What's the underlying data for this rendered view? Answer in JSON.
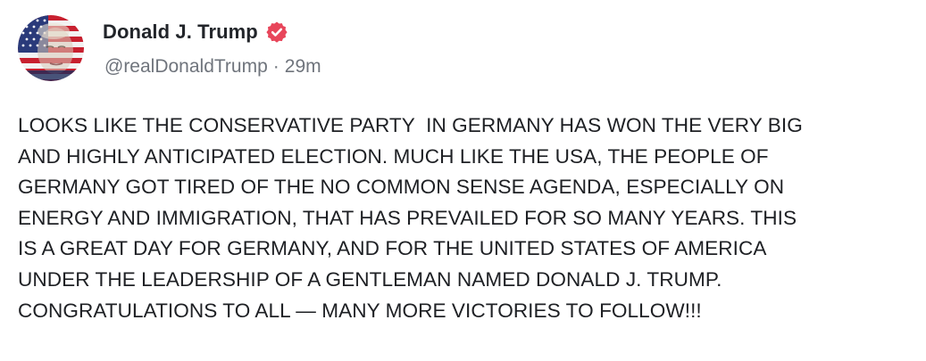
{
  "post": {
    "author": {
      "display_name": "Donald J. Trump",
      "handle": "@realDonaldTrump",
      "verified_icon": "verified-badge-icon",
      "avatar_icon": "avatar-flag-portrait"
    },
    "separator": "·",
    "timestamp": "29m",
    "body": "LOOKS LIKE THE CONSERVATIVE PARTY  IN GERMANY HAS WON THE VERY BIG\nAND HIGHLY ANTICIPATED ELECTION. MUCH LIKE THE USA, THE PEOPLE OF\nGERMANY GOT TIRED OF THE NO COMMON SENSE AGENDA, ESPECIALLY ON\nENERGY AND IMMIGRATION, THAT HAS PREVAILED FOR SO MANY YEARS. THIS\nIS A GREAT DAY FOR GERMANY, AND FOR THE UNITED STATES OF AMERICA\nUNDER THE LEADERSHIP OF A GENTLEMAN NAMED DONALD J. TRUMP.\nCONGRATULATIONS TO ALL — MANY MORE VICTORIES TO FOLLOW!!!"
  },
  "colors": {
    "verified_badge": "#e8455a",
    "name_text": "#22252a",
    "meta_text": "#6f747c",
    "body_text": "#1e2024",
    "background": "#ffffff"
  }
}
